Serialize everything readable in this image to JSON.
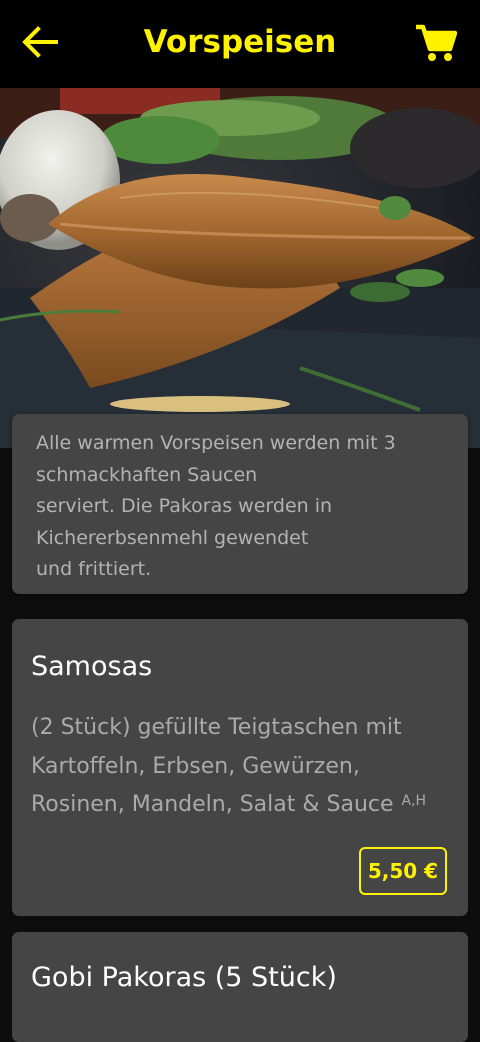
{
  "header": {
    "title": "Vorspeisen",
    "back_icon": "arrow-left-icon",
    "cart_icon": "shopping-cart-icon",
    "accent_color": "#fff200"
  },
  "hero": {
    "image": "samosas-photo"
  },
  "info": {
    "text": "Alle warmen Vorspeisen werden mit 3\nschmackhaften Saucen\nserviert. Die Pakoras werden in\nKichererbsenmehl gewendet\nund frittiert."
  },
  "items": [
    {
      "name": "Samosas",
      "description": "(2 Stück) gefüllte Teigtaschen mit Kartoffeln, Erbsen, Gewürzen, Rosinen, Mandeln, Salat & Sauce",
      "allergens": "A,H",
      "price": "5,50 €"
    },
    {
      "name": "Gobi Pakoras (5 Stück)"
    }
  ]
}
